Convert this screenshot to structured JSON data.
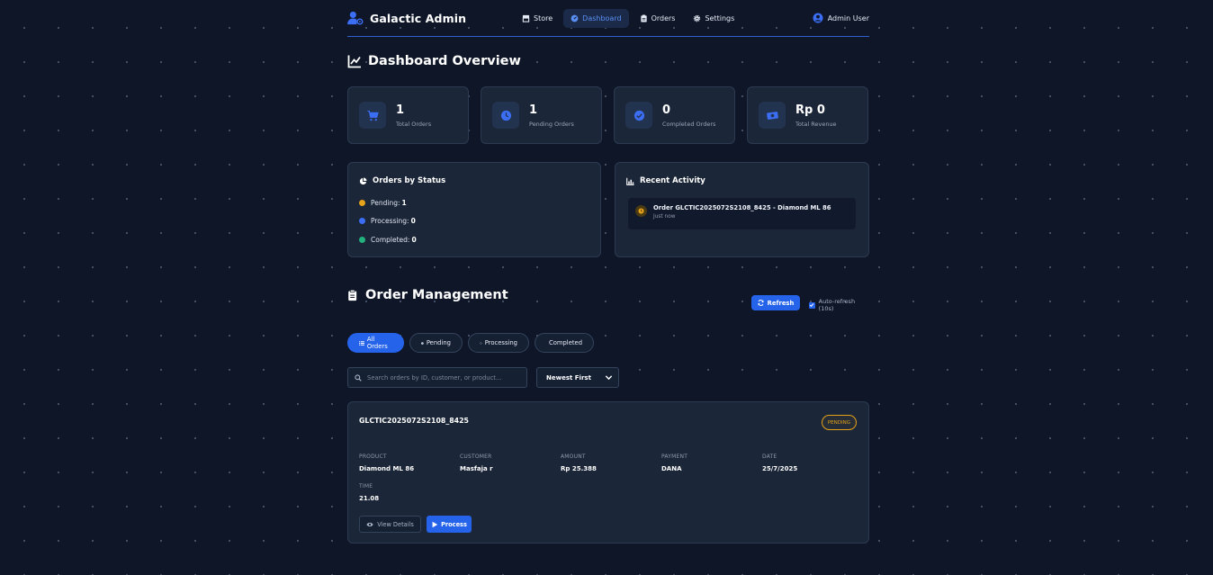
{
  "nav": {
    "brand": "Galactic Admin",
    "links": [
      {
        "label": "Store",
        "icon": "store-icon"
      },
      {
        "label": "Dashboard",
        "icon": "dashboard-icon",
        "active": true
      },
      {
        "label": "Orders",
        "icon": "clipboard-icon"
      },
      {
        "label": "Settings",
        "icon": "gear-icon"
      }
    ],
    "user": "Admin User"
  },
  "overview": {
    "title": "Dashboard Overview",
    "stats": [
      {
        "value": "1",
        "label": "Total Orders",
        "icon": "cart-icon"
      },
      {
        "value": "1",
        "label": "Pending Orders",
        "icon": "clock-icon"
      },
      {
        "value": "0",
        "label": "Completed Orders",
        "icon": "check-circle-icon"
      },
      {
        "value": "Rp 0",
        "label": "Total Revenue",
        "icon": "money-icon"
      }
    ]
  },
  "status_panel": {
    "title": "Orders by Status",
    "rows": [
      {
        "label": "Pending:",
        "value": "1",
        "color": "#e5a21a"
      },
      {
        "label": "Processing:",
        "value": "0",
        "color": "#3b6ef5"
      },
      {
        "label": "Completed:",
        "value": "0",
        "color": "#22b07d"
      }
    ]
  },
  "activity_panel": {
    "title": "Recent Activity",
    "items": [
      {
        "title": "Order GLCTIC2025072S2108_8425 - Diamond ML 86",
        "time": "Just now"
      }
    ]
  },
  "management": {
    "title": "Order Management",
    "refresh_label": "Refresh",
    "autorefresh_label": "Auto-refresh (10s)",
    "autorefresh_checked": true,
    "filters": [
      "All Orders",
      "Pending",
      "Processing",
      "Completed"
    ],
    "active_filter": "All Orders",
    "search_placeholder": "Search orders by ID, customer, or product...",
    "sort_value": "Newest First"
  },
  "orders": [
    {
      "id": "GLCTIC2025072S2108_8425",
      "status": "PENDING",
      "labels": {
        "product": "PRODUCT",
        "customer": "CUSTOMER",
        "amount": "AMOUNT",
        "payment": "PAYMENT",
        "date": "DATE",
        "time": "TIME"
      },
      "product": "Diamond ML 86",
      "customer": "Masfaja r",
      "amount": "Rp 25.388",
      "payment": "DANA",
      "date": "25/7/2025",
      "time": "21.08",
      "view_label": "View Details",
      "process_label": "Process"
    }
  ],
  "colors": {
    "accent": "#2563eb",
    "pending": "#e5a21a",
    "processing": "#3b6ef5",
    "completed": "#22b07d",
    "background": "#0e1628",
    "card": "#1b2638"
  }
}
